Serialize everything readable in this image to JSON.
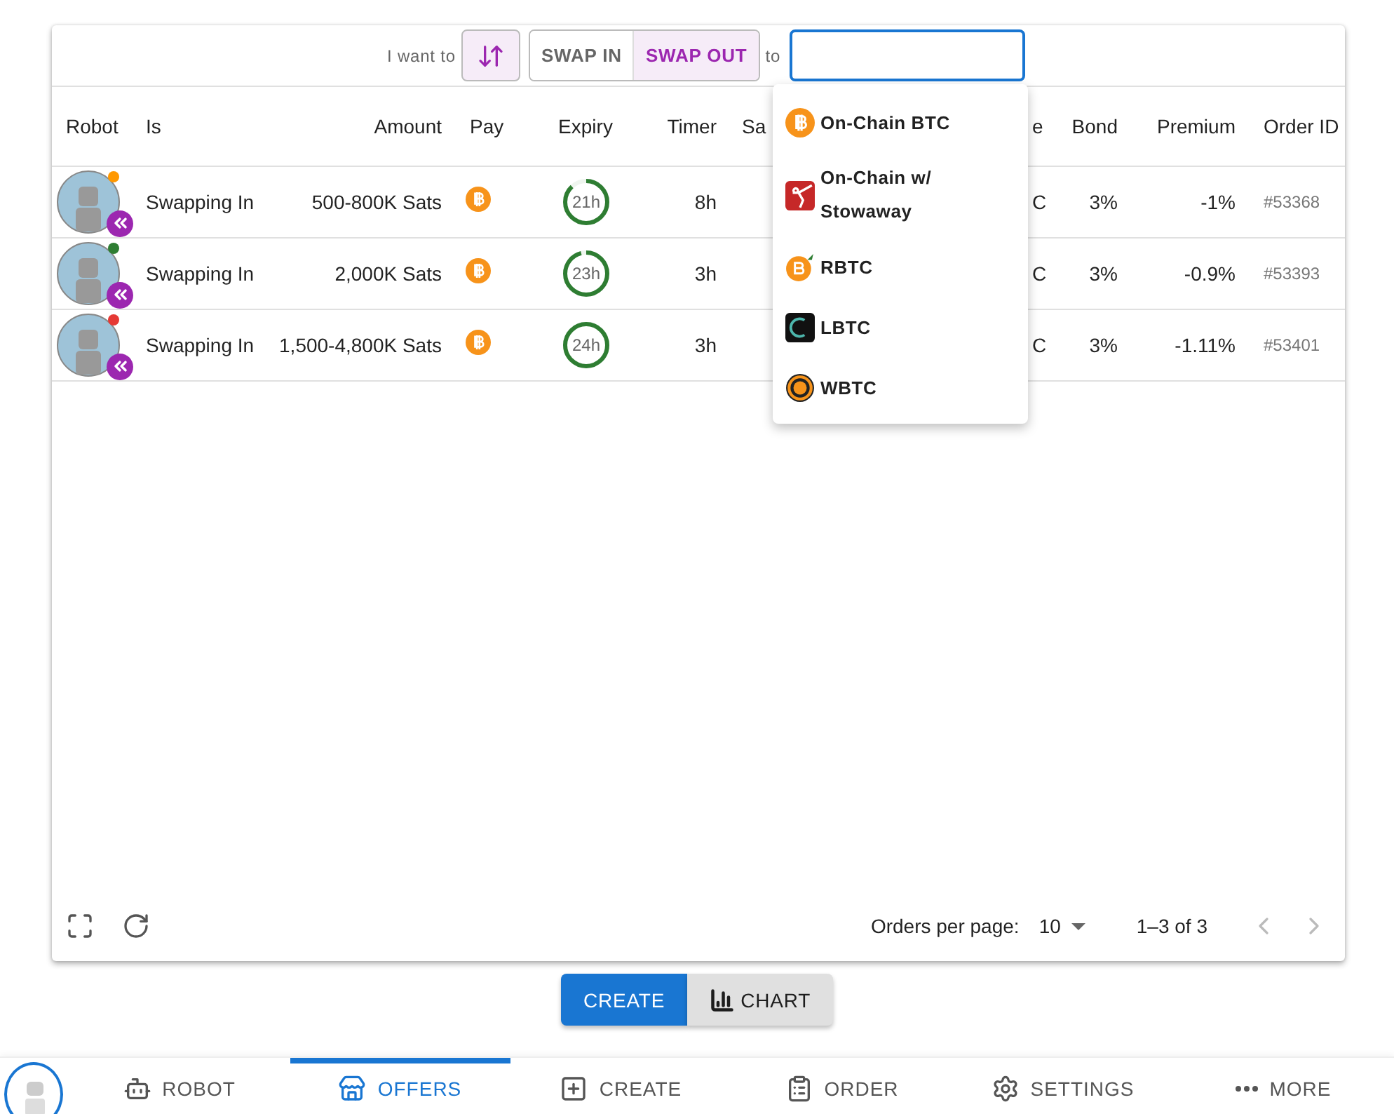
{
  "filter": {
    "label": "I want to",
    "toggles": [
      {
        "label": "SWAP IN",
        "selected": false
      },
      {
        "label": "SWAP OUT",
        "selected": true
      }
    ],
    "connector": "to",
    "currency_field": {
      "focused": true
    }
  },
  "table": {
    "columns": [
      "Robot",
      "Is",
      "Amount",
      "Pay",
      "Expiry",
      "Timer",
      "Sa",
      "e",
      "Bond",
      "Premium",
      "Order ID"
    ],
    "rows": [
      {
        "color": "#ff9800",
        "is": "Swapping In",
        "amount": "500-800K Sats",
        "expiry": {
          "label": "21h",
          "level": 0.88
        },
        "timer": "8h",
        "column_8": "C",
        "bond": "3%",
        "premium": "-1%",
        "order_id": "#53368"
      },
      {
        "color": "#2e7d32",
        "is": "Swapping In",
        "amount": "2,000K Sats",
        "expiry": {
          "label": "23h",
          "level": 0.96
        },
        "timer": "3h",
        "column_8": "C",
        "bond": "3%",
        "premium": "-0.9%",
        "order_id": "#53393"
      },
      {
        "color": "#e53935",
        "is": "Swapping In",
        "amount": "1,500-4,800K Sats",
        "expiry": {
          "label": "24h",
          "level": 1
        },
        "timer": "3h",
        "column_8": "C",
        "bond": "3%",
        "premium": "-1.11%",
        "order_id": "#53401"
      }
    ]
  },
  "dropdown": {
    "options": [
      {
        "label": "On-Chain BTC",
        "kind": "btc"
      },
      {
        "label": "On-Chain w/ Stowaway",
        "kind": "stowaway"
      },
      {
        "label": "RBTC",
        "kind": "rbtc"
      },
      {
        "label": "LBTC",
        "kind": "lbtc"
      },
      {
        "label": "WBTC",
        "kind": "wbtc"
      }
    ]
  },
  "footer": {
    "per_page_label": "Orders per page:",
    "per_page": "10",
    "range": "1–3 of 3"
  },
  "actions": [
    {
      "label": "CREATE",
      "kind": "primary"
    },
    {
      "label": "CHART",
      "kind": "secondary"
    }
  ],
  "nav": [
    {
      "label": "ROBOT",
      "kind": "robot",
      "selected": false
    },
    {
      "label": "OFFERS",
      "kind": "offers",
      "selected": true
    },
    {
      "label": "CREATE",
      "kind": "create",
      "selected": false
    },
    {
      "label": "ORDER",
      "kind": "order",
      "selected": false
    },
    {
      "label": "SETTINGS",
      "kind": "settings",
      "selected": false
    },
    {
      "label": "MORE",
      "kind": "more",
      "selected": false
    }
  ]
}
